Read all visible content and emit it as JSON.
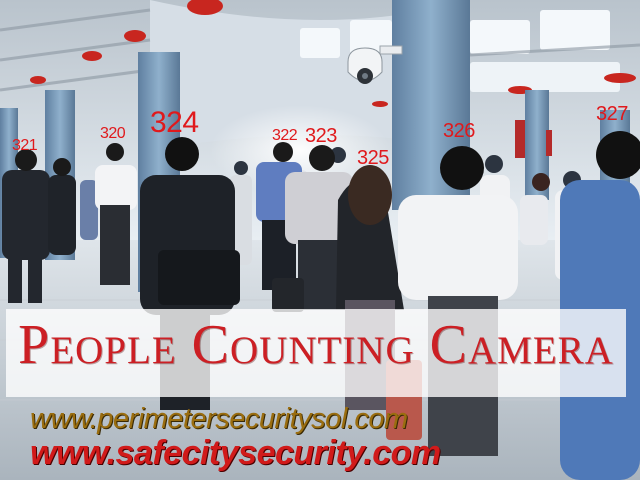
{
  "counts": [
    "321",
    "320",
    "324",
    "322",
    "323",
    "325",
    "326",
    "327"
  ],
  "banner": {
    "title": "People Counting Camera"
  },
  "urls": {
    "primary": "www.perimetersecuritysol.com",
    "secondary": "www.safecitysecurity.com"
  },
  "colors": {
    "count_text": "#e0191c",
    "title": "#cc1f24",
    "url_primary": "#9a6d0f",
    "url_secondary": "#d11a1a"
  }
}
